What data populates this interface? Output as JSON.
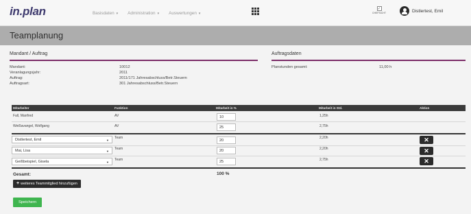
{
  "app": {
    "logo_text": "in",
    "logo_dot": ".",
    "logo_text2": "plan"
  },
  "nav": [
    {
      "label": "Basisdaten"
    },
    {
      "label": "Administration"
    },
    {
      "label": "Auswertungen"
    }
  ],
  "header": {
    "checkbox_label": "CHEFSICHT",
    "user_name": "Distlertest, Emil",
    "user_icon": "user-circle-icon",
    "apps_icon": "grid-icon"
  },
  "page": {
    "title": "Teamplanung"
  },
  "mandant_section": {
    "title": "Mandant / Auftrag",
    "rows": [
      {
        "label": "Mandant:",
        "value": "10012"
      },
      {
        "label": "Veranlagungsjahr:",
        "value": "2011"
      },
      {
        "label": "Auftrag:",
        "value": "2011/171 Jahresabschluss/Betr.Steuern"
      },
      {
        "label": "Auftragsart:",
        "value": "301 Jahresabschluss/Betr.Steuern"
      }
    ]
  },
  "auftrag_section": {
    "title": "Auftragsdaten",
    "rows": [
      {
        "label": "Planstunden gesamt:",
        "value": "11,00 h"
      }
    ]
  },
  "table": {
    "headers": [
      "Mitarbeiter",
      "Funktion",
      "Mitarbeit in %",
      "Mitarbeit in Std.",
      "Aktion"
    ],
    "fixed_rows": [
      {
        "mitarbeiter": "Fall, Manfred",
        "funktion": "AV",
        "prozent": "10",
        "stunden": "1,25h"
      },
      {
        "mitarbeiter": "Weißavangel, Wolfgang",
        "funktion": "AV",
        "prozent": "25",
        "stunden": "2,75h"
      }
    ],
    "team_rows": [
      {
        "mitarbeiter": "Distlertest, Emil",
        "funktion": "Team",
        "prozent": "20",
        "stunden": "2,20h"
      },
      {
        "mitarbeiter": "Mai, Lisa",
        "funktion": "Team",
        "prozent": "20",
        "stunden": "2,20h"
      },
      {
        "mitarbeiter": "Geißbeispiel, Gisela",
        "funktion": "Team",
        "prozent": "25",
        "stunden": "2,75h"
      }
    ],
    "delete_glyph": "✕"
  },
  "totals": {
    "label": "Gesamt:",
    "value": "100 %"
  },
  "buttons": {
    "add_label": "weiteres Teammitglied hinzufügen",
    "add_glyph": "+",
    "save_label": "Speichern"
  },
  "colors": {
    "accent": "#7a2b67",
    "save": "#3fb54f",
    "dark": "#2b2b2b",
    "titlebar": "#adadad"
  }
}
